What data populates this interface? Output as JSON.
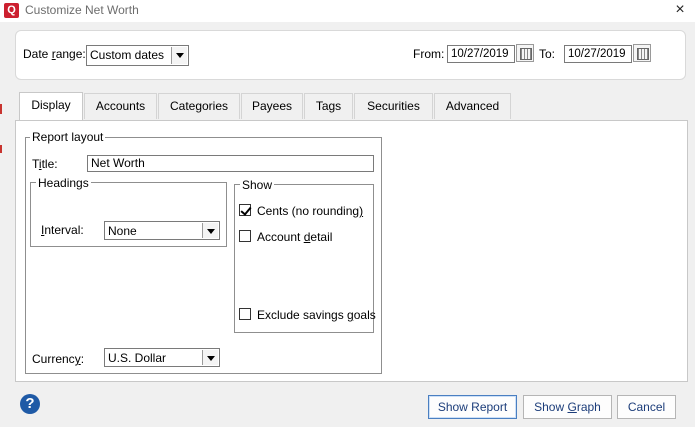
{
  "window": {
    "app_icon_letter": "Q",
    "title": "Customize Net Worth",
    "close_glyph": "×"
  },
  "date_range": {
    "label_pre": "Date ",
    "label_u": "r",
    "label_post": "ange:",
    "selected": "Custom dates",
    "from_label": "From:",
    "from_value": "10/27/2019",
    "to_label": "To:",
    "to_value": "10/27/2019"
  },
  "tabs": [
    {
      "label": "Display"
    },
    {
      "label": "Accounts"
    },
    {
      "label": "Categories"
    },
    {
      "label": "Payees"
    },
    {
      "label": "Tags"
    },
    {
      "label": "Securities"
    },
    {
      "label": "Advanced"
    }
  ],
  "report_layout": {
    "group_label": "Report layout",
    "title_label_pre": "T",
    "title_label_u": "i",
    "title_label_post": "tle:",
    "title_value": "Net Worth",
    "headings_label": "Headings",
    "interval_label_pre": "",
    "interval_label_u": "I",
    "interval_label_post": "nterval:",
    "interval_value": "None",
    "currency_label_pre": "Currenc",
    "currency_label_u": "y",
    "currency_label_post": ":",
    "currency_value": "U.S. Dollar"
  },
  "show": {
    "group_label": "Show",
    "options": [
      {
        "pre": "Cents (no rounding",
        "u": ")",
        "post": "",
        "checked": true
      },
      {
        "pre": "Account ",
        "u": "d",
        "post": "etail",
        "checked": false
      },
      {
        "pre": "Exclude savings ",
        "u": "g",
        "post": "oals",
        "checked": false
      }
    ]
  },
  "buttons": {
    "help_glyph": "?",
    "show_report": "Show Report",
    "show_graph_pre": "Show ",
    "show_graph_u": "G",
    "show_graph_post": "raph",
    "cancel": "Cancel"
  },
  "icons": {
    "help": "help-icon",
    "calendar": "calendar-icon",
    "dropdown": "chevron-down-icon",
    "close": "close-icon"
  },
  "colors": {
    "brand_red": "#cc1f2f",
    "help_blue": "#1f5aa6",
    "button_text": "#1c3d7a"
  }
}
